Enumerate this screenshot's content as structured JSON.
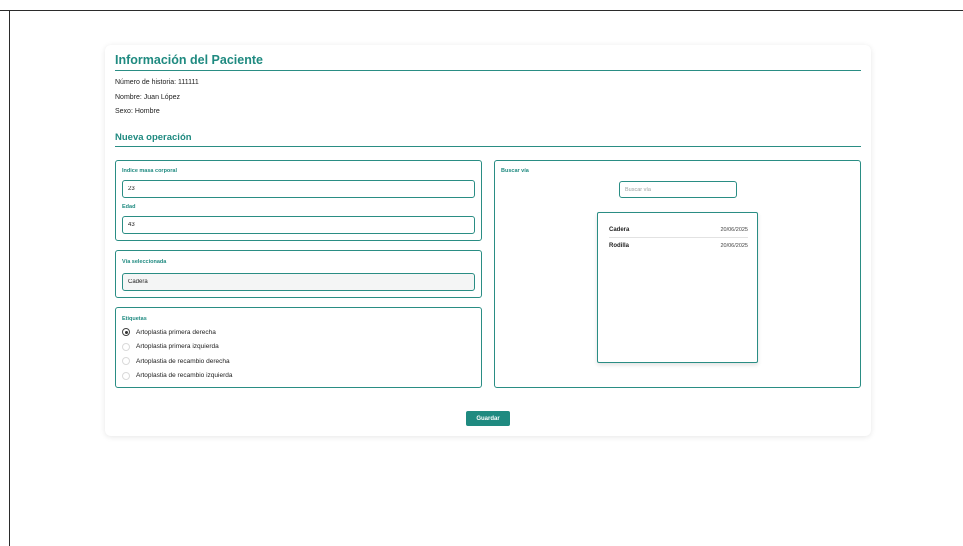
{
  "patient": {
    "title": "Información del Paciente",
    "history_number": "Número de historia: 111111",
    "name": "Nombre: Juan López",
    "sex": "Sexo: Hombre"
  },
  "operation": {
    "title": "Nueva operación",
    "bmi": {
      "label": "Indice masa corporal",
      "value": "23"
    },
    "age": {
      "label": "Edad",
      "value": "43"
    },
    "selected_route": {
      "label": "Vía seleccionada",
      "value": "Cadera"
    },
    "tags": {
      "label": "Etiquetas",
      "options": [
        {
          "label": "Artoplastia primera derecha",
          "checked": true
        },
        {
          "label": "Artoplastia primera izquierda",
          "checked": false
        },
        {
          "label": "Artoplastia de recambio derecha",
          "checked": false
        },
        {
          "label": "Artoplastia de recambio izquierda",
          "checked": false
        }
      ]
    },
    "search": {
      "label": "Buscar vía",
      "placeholder": "Buscar vía",
      "results": [
        {
          "name": "Cadera",
          "date": "20/06/2025"
        },
        {
          "name": "Rodilla",
          "date": "20/06/2025"
        }
      ]
    },
    "save_label": "Guardar"
  },
  "colors": {
    "accent": "#1f8a80",
    "border": "#2a8d84"
  }
}
